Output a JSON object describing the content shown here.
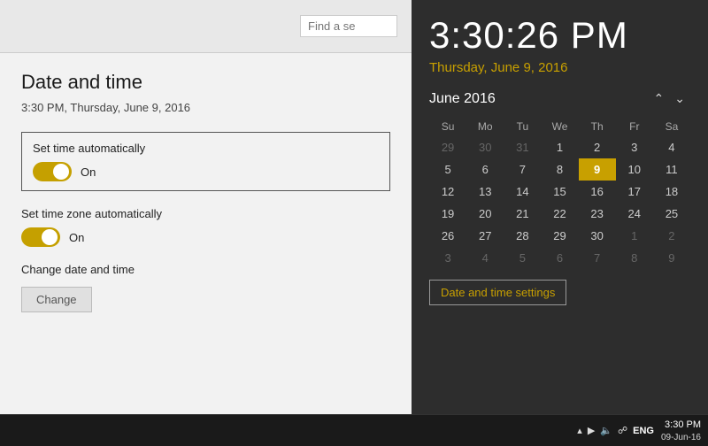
{
  "clock": {
    "time": "3:30:26 PM",
    "date_full": "Thursday, June 9, 2016",
    "date_short": "3:30 PM"
  },
  "left_panel": {
    "search_placeholder": "Find a se",
    "title": "Date and time",
    "current_datetime": "3:30 PM, Thursday, June 9, 2016",
    "set_time_auto": {
      "label": "Set time automatically",
      "state": "On"
    },
    "set_timezone_auto": {
      "label": "Set time zone automatically",
      "state": "On"
    },
    "change_datetime": {
      "label": "Change date and time",
      "button": "Change"
    }
  },
  "calendar": {
    "month_year": "June 2016",
    "days_of_week": [
      "Su",
      "Mo",
      "Tu",
      "We",
      "Th",
      "Fr",
      "Sa"
    ],
    "weeks": [
      [
        "29",
        "30",
        "31",
        "1",
        "2",
        "3",
        "4"
      ],
      [
        "5",
        "6",
        "7",
        "8",
        "9",
        "10",
        "11"
      ],
      [
        "12",
        "13",
        "14",
        "15",
        "16",
        "17",
        "18"
      ],
      [
        "19",
        "20",
        "21",
        "22",
        "23",
        "24",
        "25"
      ],
      [
        "26",
        "27",
        "28",
        "29",
        "30",
        "1",
        "2"
      ],
      [
        "3",
        "4",
        "5",
        "6",
        "7",
        "8",
        "9"
      ]
    ],
    "today_row": 1,
    "today_col": 4,
    "other_month_cells": {
      "row0": [
        0,
        1,
        2
      ],
      "row4": [
        5,
        6
      ],
      "row5": [
        0,
        1,
        2,
        3,
        4,
        5,
        6
      ]
    }
  },
  "date_time_settings_link": "Date and time settings",
  "taskbar": {
    "lang": "ENG",
    "time": "3:30 PM",
    "date": "09-Jun-16"
  }
}
